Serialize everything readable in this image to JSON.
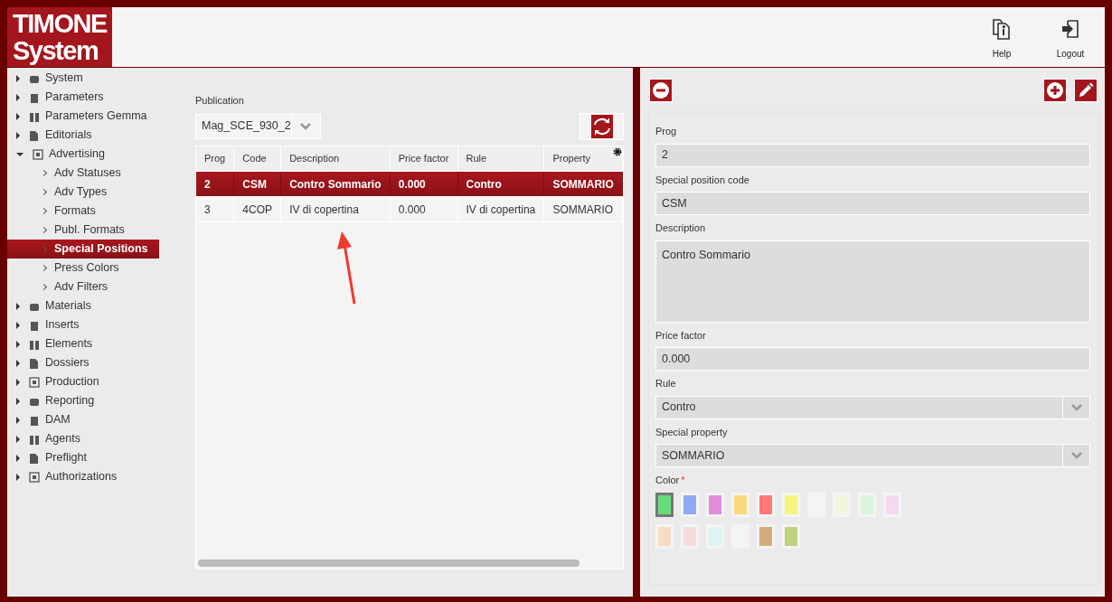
{
  "logo": {
    "line1": "TIMONE",
    "line2": "System"
  },
  "header_actions": [
    {
      "label": "Help",
      "kind": "help"
    },
    {
      "label": "Logout",
      "kind": "logout"
    }
  ],
  "sidebar": {
    "items": [
      {
        "label": "System",
        "expanded": false,
        "selected": false
      },
      {
        "label": "Parameters",
        "expanded": false,
        "selected": false
      },
      {
        "label": "Parameters Gemma",
        "expanded": false,
        "selected": false
      },
      {
        "label": "Editorials",
        "expanded": false,
        "selected": false
      },
      {
        "label": "Advertising",
        "expanded": true,
        "selected": false,
        "children": [
          {
            "label": "Adv Statuses",
            "selected": false
          },
          {
            "label": "Adv Types",
            "selected": false
          },
          {
            "label": "Formats",
            "selected": false
          },
          {
            "label": "Publ. Formats",
            "selected": false
          },
          {
            "label": "Special Positions",
            "selected": true
          },
          {
            "label": "Press Colors",
            "selected": false
          },
          {
            "label": "Adv Filters",
            "selected": false
          }
        ]
      },
      {
        "label": "Materials",
        "expanded": false,
        "selected": false
      },
      {
        "label": "Inserts",
        "expanded": false,
        "selected": false
      },
      {
        "label": "Elements",
        "expanded": false,
        "selected": false
      },
      {
        "label": "Dossiers",
        "expanded": false,
        "selected": false
      },
      {
        "label": "Production",
        "expanded": false,
        "selected": false
      },
      {
        "label": "Reporting",
        "expanded": false,
        "selected": false
      },
      {
        "label": "DAM",
        "expanded": false,
        "selected": false
      },
      {
        "label": "Agents",
        "expanded": false,
        "selected": false
      },
      {
        "label": "Preflight",
        "expanded": false,
        "selected": false
      },
      {
        "label": "Authorizations",
        "expanded": false,
        "selected": false
      }
    ]
  },
  "publication": {
    "label": "Publication",
    "value": "Mag_SCE_930_2"
  },
  "table": {
    "columns": [
      "Prog",
      "Code",
      "Description",
      "Price factor",
      "Rule",
      "Property"
    ],
    "rows": [
      {
        "cells": [
          "2",
          "CSM",
          "Contro Sommario",
          "0.000",
          "Contro",
          "SOMMARIO"
        ],
        "selected": true
      },
      {
        "cells": [
          "3",
          "4COP",
          "IV di copertina",
          "0.000",
          "IV di copertina",
          "SOMMARIO"
        ],
        "selected": false
      }
    ]
  },
  "form": {
    "fields": [
      {
        "label": "Prog",
        "value": "2",
        "kind": "text"
      },
      {
        "label": "Special position code",
        "value": "CSM",
        "kind": "text"
      },
      {
        "label": "Description",
        "value": "Contro Sommario",
        "kind": "textarea"
      },
      {
        "label": "Price factor",
        "value": "0.000",
        "kind": "text"
      },
      {
        "label": "Rule",
        "value": "Contro",
        "kind": "select"
      },
      {
        "label": "Special property",
        "value": "SOMMARIO",
        "kind": "select"
      }
    ],
    "color_label": "Color",
    "required_mark": "*",
    "swatch_rows": [
      [
        {
          "color": "#66dd7a",
          "selected": true
        },
        {
          "color": "#8eaaf2",
          "selected": false
        },
        {
          "color": "#e08ed8",
          "selected": false
        },
        {
          "color": "#f8da7e",
          "selected": false
        },
        {
          "color": "#ff7777",
          "selected": false
        },
        {
          "color": "#f4f47e",
          "selected": false
        },
        {
          "color": "#f4f4f4",
          "selected": false
        },
        {
          "color": "#f2f4dc",
          "selected": false
        },
        {
          "color": "#d8f4dc",
          "selected": false
        },
        {
          "color": "#f6d8f0",
          "selected": false
        }
      ],
      [
        {
          "color": "#f6dcc4",
          "selected": false
        },
        {
          "color": "#f6dcdc",
          "selected": false
        },
        {
          "color": "#dcf4f4",
          "selected": false
        },
        {
          "color": "#f4f4f4",
          "selected": false
        },
        {
          "color": "#d4ac7c",
          "selected": false
        },
        {
          "color": "#c0d27e",
          "selected": false
        }
      ]
    ]
  }
}
